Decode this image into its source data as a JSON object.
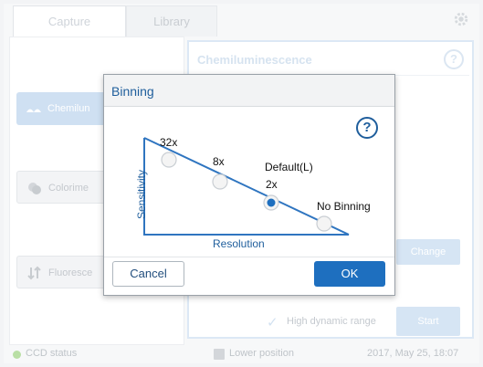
{
  "tabs": [
    {
      "label": "Capture"
    },
    {
      "label": "Library"
    }
  ],
  "modes": [
    {
      "label": "Chemilun",
      "icon": "chemi-icon",
      "state": "selected"
    },
    {
      "label": "Colorime",
      "icon": "colorimetric-icon"
    },
    {
      "label": "Fluoresce",
      "icon": "fluorescence-icon"
    }
  ],
  "right_panel": {
    "title": "Chemiluminescence",
    "help": "?",
    "change_label": "Change",
    "hdr_label": "High dynamic range",
    "start_label": "Start"
  },
  "status": {
    "ccd": "CCD status",
    "lower": "Lower position",
    "date": "2017, May 25, 18:07"
  },
  "dialog": {
    "title": "Binning",
    "help": "?",
    "y_axis": "Sensitivity",
    "x_axis": "Resolution",
    "options": [
      {
        "label": "32x",
        "selected": false
      },
      {
        "label": "8x",
        "selected": false
      },
      {
        "label": "2x",
        "caption": "Default(L)",
        "selected": true
      },
      {
        "label": "No Binning",
        "selected": false
      }
    ],
    "cancel_label": "Cancel",
    "ok_label": "OK"
  },
  "colors": {
    "accent": "#1e6fbf",
    "title_blue": "#1f5e9c",
    "line_blue": "#2f75c0"
  }
}
